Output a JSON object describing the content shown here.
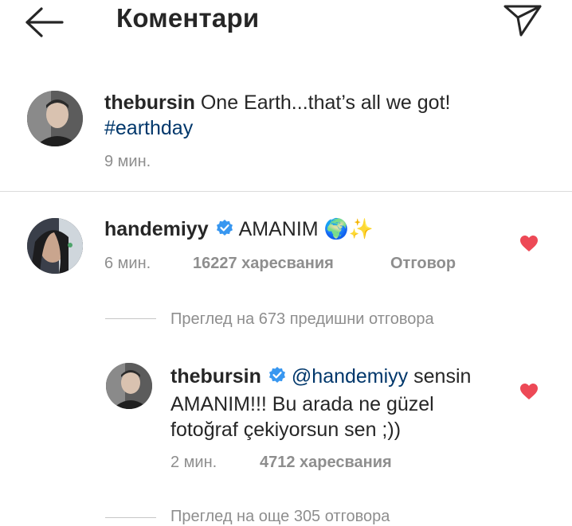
{
  "header": {
    "title": "Коментари"
  },
  "caption": {
    "username": "thebursin",
    "text": "One Earth...that’s all we got!",
    "hashtag": "#earthday",
    "time": "9 мин."
  },
  "comment": {
    "username": "handemiyy",
    "text": "AMANIM",
    "emoji": "🌍✨",
    "time": "6 мин.",
    "likes": "16227 харесвания",
    "reply_label": "Отговор",
    "view_previous": "Преглед на 673 предишни отговора"
  },
  "reply": {
    "username": "thebursin",
    "mention": "@handemiyy",
    "text_line1_rest": "sensin",
    "text_line2": "AMANIM!!! Bu arada ne güzel",
    "text_line3": "fotoğraf çekiyorsun sen ;))",
    "time": "2 мин.",
    "likes": "4712 харесвания",
    "view_more": "Преглед на още 305 отговора"
  },
  "colors": {
    "text": "#262626",
    "secondary": "#8e8e8e",
    "link": "#00376b",
    "verified": "#3897f0",
    "heart": "#ed4956",
    "divider": "#dbdbdb"
  }
}
